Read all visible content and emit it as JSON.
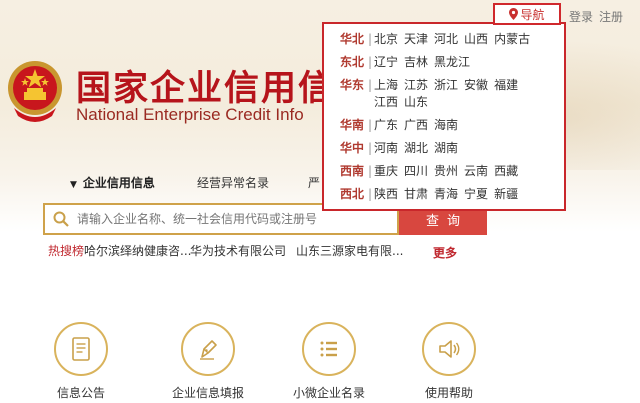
{
  "header": {
    "site_title": "国家企业信用信",
    "site_subtitle": "National Enterprise Credit Info",
    "nav_label": "导航",
    "login": "登录",
    "register": "注册"
  },
  "region_menu": [
    {
      "name": "华北",
      "cities": [
        "北京",
        "天津",
        "河北",
        "山西",
        "内蒙古"
      ]
    },
    {
      "name": "东北",
      "cities": [
        "辽宁",
        "吉林",
        "黑龙江"
      ]
    },
    {
      "name": "华东",
      "cities": [
        "上海",
        "江苏",
        "浙江",
        "安徽",
        "福建",
        "江西",
        "山东"
      ]
    },
    {
      "name": "华南",
      "cities": [
        "广东",
        "广西",
        "海南"
      ]
    },
    {
      "name": "华中",
      "cities": [
        "河南",
        "湖北",
        "湖南"
      ]
    },
    {
      "name": "西南",
      "cities": [
        "重庆",
        "四川",
        "贵州",
        "云南",
        "西藏"
      ]
    },
    {
      "name": "西北",
      "cities": [
        "陕西",
        "甘肃",
        "青海",
        "宁夏",
        "新疆"
      ]
    }
  ],
  "main_nav": {
    "active": "企业信用信息",
    "abnormal": "经营异常名录",
    "serious": "严"
  },
  "search": {
    "placeholder": "请输入企业名称、统一社会信用代码或注册号",
    "button": "查询"
  },
  "hot_search": {
    "label": "热搜榜",
    "items": [
      "哈尔滨绎纳健康咨...",
      "华为技术有限公司",
      "山东三源家电有限..."
    ],
    "more": "更多"
  },
  "services": [
    {
      "label": "信息公告",
      "icon": "notice-icon"
    },
    {
      "label": "企业信息填报",
      "icon": "pen-icon"
    },
    {
      "label": "小微企业名录",
      "icon": "list-icon"
    },
    {
      "label": "使用帮助",
      "icon": "speaker-icon"
    }
  ],
  "colors": {
    "brand_red": "#b6141b",
    "accent_gold": "#d9b35c",
    "search_button": "#d8473f"
  }
}
